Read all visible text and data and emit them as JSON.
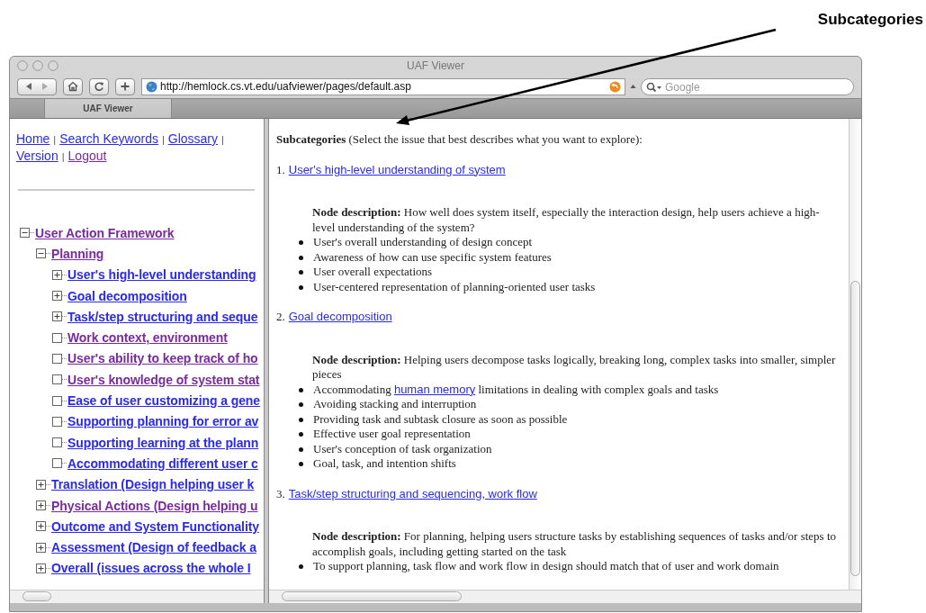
{
  "annotation": {
    "label": "Subcategories"
  },
  "window": {
    "title": "UAF Viewer"
  },
  "toolbar": {
    "address": "http://hemlock.cs.vt.edu/uafviewer/pages/default.asp",
    "search": {
      "placeholder": "Google"
    }
  },
  "tabs": [
    {
      "label": "UAF Viewer",
      "selected": true
    }
  ],
  "nav": [
    {
      "kind": "link",
      "label": "Home",
      "visited": false
    },
    {
      "kind": "separator",
      "label": "|"
    },
    {
      "kind": "link",
      "label": "Search Keywords",
      "visited": false
    },
    {
      "kind": "separator",
      "label": "|"
    },
    {
      "kind": "link",
      "label": "Glossary",
      "visited": false
    },
    {
      "kind": "separator",
      "label": "|"
    },
    {
      "kind": "break"
    },
    {
      "kind": "link",
      "label": "Version",
      "visited": false
    },
    {
      "kind": "separator",
      "label": "|"
    },
    {
      "kind": "link",
      "label": "Logout",
      "visited": true
    }
  ],
  "tree": [
    {
      "label": "User Action Framework",
      "visited": true,
      "kind": "branch",
      "expanded": true,
      "children": [
        {
          "label": "Planning",
          "visited": true,
          "kind": "branch",
          "expanded": true,
          "children": [
            {
              "label": "User's high-level understanding",
              "visited": false,
              "kind": "branch",
              "expanded": false
            },
            {
              "label": "Goal decomposition",
              "visited": false,
              "kind": "branch",
              "expanded": false
            },
            {
              "label": "Task/step structuring and seque",
              "visited": false,
              "kind": "branch",
              "expanded": false
            },
            {
              "label": "Work context, environment",
              "visited": true,
              "kind": "leaf"
            },
            {
              "label": "User's ability to keep track of ho",
              "visited": true,
              "kind": "leaf"
            },
            {
              "label": "User's knowledge of system stat",
              "visited": true,
              "kind": "leaf"
            },
            {
              "label": "Ease of user customizing a gene",
              "visited": false,
              "kind": "leaf"
            },
            {
              "label": "Supporting planning for error av",
              "visited": false,
              "kind": "leaf"
            },
            {
              "label": "Supporting learning at the plann",
              "visited": false,
              "kind": "leaf"
            },
            {
              "label": "Accommodating different user c",
              "visited": false,
              "kind": "leaf"
            }
          ]
        },
        {
          "label": "Translation (Design helping user k",
          "visited": false,
          "kind": "branch",
          "expanded": false
        },
        {
          "label": "Physical Actions (Design helping u",
          "visited": true,
          "kind": "branch",
          "expanded": false
        },
        {
          "label": "Outcome and System Functionality",
          "visited": false,
          "kind": "branch",
          "expanded": false
        },
        {
          "label": "Assessment (Design of feedback a",
          "visited": false,
          "kind": "branch",
          "expanded": false
        },
        {
          "label": "Overall (issues across the whole I",
          "visited": false,
          "kind": "branch",
          "expanded": false
        }
      ]
    }
  ],
  "content": {
    "intro": "**Subcategories** (Select the issue that best describes what you want to explore):",
    "items": [
      {
        "number": "1.",
        "title": "User's high-level understanding of system",
        "description": "**Node description:** How well does system itself, especially the interaction design, help users achieve a high-level understanding of the system?",
        "bullets": [
          {
            "text": "User's overall understanding of design concept"
          },
          {
            "text": "Awareness of how can use specific system features"
          },
          {
            "text": "User overall expectations"
          },
          {
            "text": "User-centered representation of planning-oriented user tasks"
          }
        ]
      },
      {
        "number": "2.",
        "title": "Goal decomposition",
        "description": "**Node description:** Helping users decompose tasks logically, breaking long, complex tasks into smaller, simpler pieces",
        "bullets": [
          {
            "text": "Accommodating",
            "link": "human memory",
            "after": "limitations in dealing with complex goals and tasks"
          },
          {
            "text": "Avoiding stacking and interruption"
          },
          {
            "text": "Providing task and subtask closure as soon as possible"
          },
          {
            "text": "Effective user goal representation"
          },
          {
            "text": "User's conception of task organization"
          },
          {
            "text": "Goal, task, and intention shifts"
          }
        ]
      },
      {
        "number": "3.",
        "title": "Task/step structuring and sequencing, work flow",
        "description": "**Node description:** For planning, helping users structure tasks by establishing sequences of tasks and/or steps to accomplish goals, including getting started on the task",
        "bullets": [
          {
            "text": "To support planning, task flow and work flow in design should match that of user and work domain"
          }
        ]
      }
    ]
  }
}
